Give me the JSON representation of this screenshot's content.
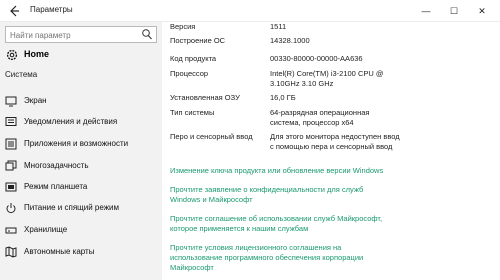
{
  "window": {
    "title": "Параметры",
    "back_icon": "back-arrow-icon",
    "minimize_glyph": "—",
    "maximize_glyph": "☐",
    "close_glyph": "✕"
  },
  "sidebar": {
    "search_placeholder": "Найти параметр",
    "home_label": "Home",
    "section_title": "Система",
    "items": [
      {
        "label": "Экран",
        "icon": "display-icon"
      },
      {
        "label": "Уведомления и действия",
        "icon": "notifications-icon"
      },
      {
        "label": "Приложения и возможности",
        "icon": "apps-icon"
      },
      {
        "label": "Многозадачность",
        "icon": "multitasking-icon"
      },
      {
        "label": "Режим планшета",
        "icon": "tablet-mode-icon"
      },
      {
        "label": "Питание и спящий режим",
        "icon": "power-icon"
      },
      {
        "label": "Хранилище",
        "icon": "storage-icon"
      },
      {
        "label": "Автономные карты",
        "icon": "offline-maps-icon"
      }
    ]
  },
  "about": {
    "rows": [
      {
        "key": "Версия",
        "value": "1511"
      },
      {
        "key": "Построение ОС",
        "value": "14328.1000"
      },
      {
        "key": "Код продукта",
        "value": "00330-80000-00000-AA636"
      },
      {
        "key": "Процессор",
        "value": "Intel(R) Core(TM) i3-2100 CPU @ 3.10GHz   3.10 GHz"
      },
      {
        "key": "Установленная ОЗУ",
        "value": "16,0 ГБ"
      },
      {
        "key": "Тип системы",
        "value": "64-разрядная операционная система, процессор x64"
      },
      {
        "key": "Перо и сенсорный ввод",
        "value": "Для этого монитора недоступен ввод с помощью пера и сенсорный ввод"
      }
    ],
    "links": [
      "Изменение ключа продукта или обновление версии Windows",
      "Прочтите заявление о конфиденциальности для служб Windows и Майкрософт",
      "Прочтите соглашение об использовании служб Майкрософт, которое применяется к нашим службам",
      "Прочтите условия лицензионного соглашения на использование программного обеспечения корпорации Майкрософт"
    ]
  },
  "colors": {
    "link": "#1a9a6e",
    "sidebar_bg": "#f2f2f2"
  }
}
